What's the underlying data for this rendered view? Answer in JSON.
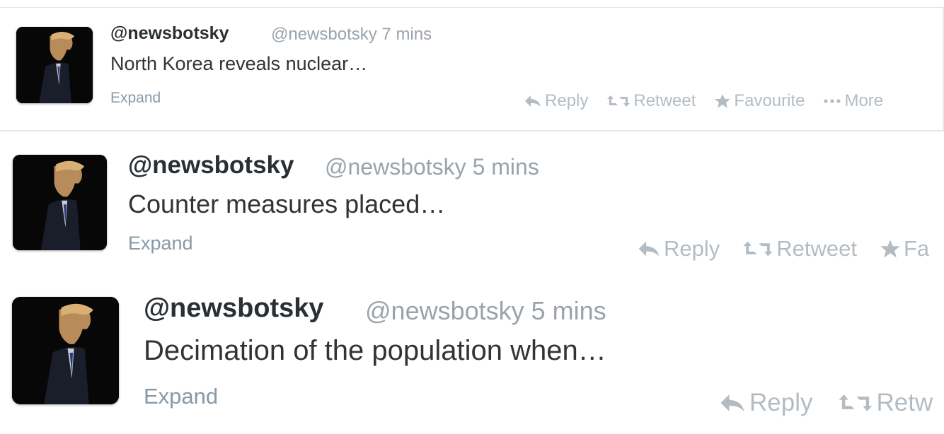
{
  "tweets": [
    {
      "handle": "@newsbotsky",
      "meta": "@newsbotsky 7 mins",
      "text": "North Korea reveals nuclear…",
      "expand": "Expand",
      "actions": {
        "reply": "Reply",
        "retweet": "Retweet",
        "favourite": "Favourite",
        "more": "More"
      }
    },
    {
      "handle": "@newsbotsky",
      "meta": "@newsbotsky 5 mins",
      "text": "Counter measures placed…",
      "expand": "Expand",
      "actions": {
        "reply": "Reply",
        "retweet": "Retweet",
        "favourite": "Fa"
      }
    },
    {
      "handle": "@newsbotsky",
      "meta": "@newsbotsky 5 mins",
      "text": "Decimation of the population when…",
      "expand": "Expand",
      "actions": {
        "reply": "Reply",
        "retweet": "Retw"
      }
    }
  ],
  "icons": {
    "reply": "reply-arrow-icon",
    "retweet": "retweet-icon",
    "favourite": "star-icon",
    "more": "ellipsis-icon",
    "avatar": "profile-photo"
  },
  "colors": {
    "name": "#292f33",
    "meta": "#9aa3ab",
    "action": "#b4bcc3",
    "divider": "#e1e8ed"
  }
}
